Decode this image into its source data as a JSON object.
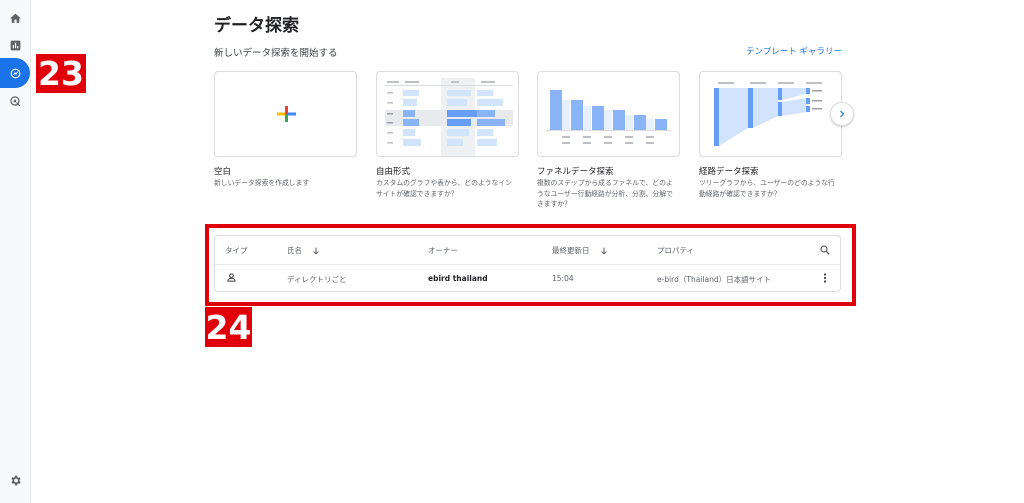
{
  "header": {
    "title": "データ探索",
    "section_title": "新しいデータ探索を開始する",
    "gallery_link": "テンプレート ギャラリー"
  },
  "nav_icons": [
    "home-icon",
    "reports-icon",
    "explore-icon",
    "advertising-icon",
    "settings-icon"
  ],
  "templates": [
    {
      "title": "空白",
      "desc": "新しいデータ探索を作成します"
    },
    {
      "title": "自由形式",
      "desc": "カスタムのグラフや表から、どのようなインサイトが確認できますか？"
    },
    {
      "title": "ファネルデータ探索",
      "desc": "複数のステップから成るファネルで、どのようなユーザー行動経路が分析、分割、分解できますか？"
    },
    {
      "title": "経路データ探索",
      "desc": "ツリーグラフから、ユーザーのどのような行動経路が確認できますか？"
    }
  ],
  "table": {
    "headers": {
      "type": "タイプ",
      "name": "氏名",
      "owner": "オーナー",
      "modified": "最終更新日",
      "property": "プロパティ"
    },
    "rows": [
      {
        "name": "ディレクトリごと",
        "owner": "ebird thailand",
        "modified": "15:04",
        "property": "e-bird（Thailand）日本語サイト"
      }
    ]
  },
  "markers": {
    "a": "23",
    "b": "24"
  },
  "colors": {
    "accent": "#1a73e8",
    "marker": "#e0000a",
    "chart_blue": "#8ab4f8"
  }
}
